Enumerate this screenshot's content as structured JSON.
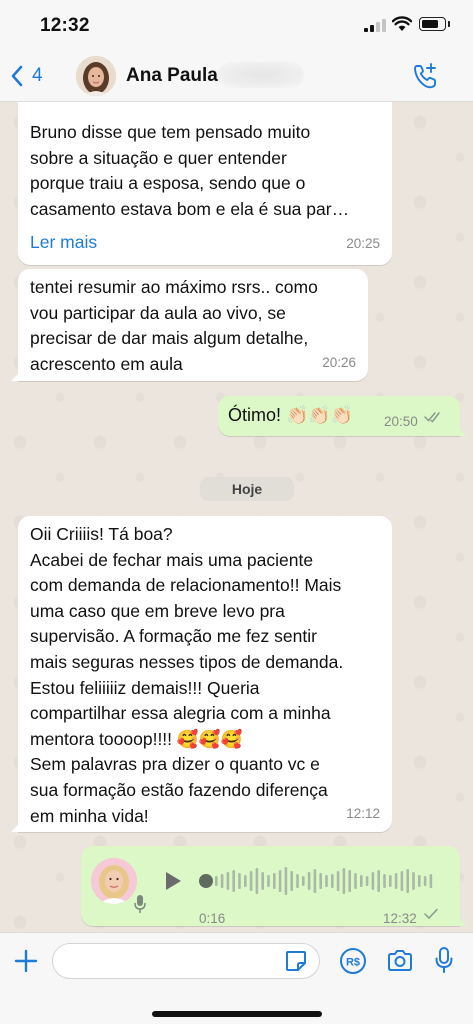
{
  "status_bar": {
    "time": "12:32"
  },
  "header": {
    "back_count": "4",
    "contact_name": "Ana Paula"
  },
  "messages": [
    {
      "direction": "incoming",
      "text": "Bruno disse que tem pensado muito\nsobre a situação e quer entender\nporque traiu a esposa, sendo que o\ncasamento estava bom e ela é sua par…",
      "read_more": "Ler mais",
      "time": "20:25"
    },
    {
      "direction": "incoming",
      "text": "tentei resumir ao máximo rsrs.. como\nvou participar da aula ao vivo, se\nprecisar de dar mais algum detalhe,\nacrescento em aula",
      "time": "20:26"
    },
    {
      "direction": "outgoing",
      "text": "Ótimo! 👏🏻👏🏻👏🏻",
      "time": "20:50",
      "status": "read"
    },
    {
      "direction": "incoming",
      "text": "Oii Criiiis! Tá boa?\nAcabei de fechar mais uma paciente\ncom demanda de relacionamento!! Mais\numa caso que em breve levo pra\nsupervisão. A formação me fez sentir\nmais seguras nesses tipos de demanda.\nEstou feliiiiiz demais!!! Queria\ncompartilhar essa alegria com a minha\nmentora toooop!!!! 🥰🥰🥰\nSem palavras pra dizer o quanto vc e\nsua formação estão fazendo diferença\nem minha vida!",
      "time": "12:12"
    },
    {
      "direction": "outgoing",
      "type": "voice",
      "duration": "0:16",
      "time": "12:32",
      "status": "delivered"
    }
  ],
  "day_separator": "Hoje",
  "colors": {
    "accent": "#1f7bd6",
    "outgoing_bubble": "#dcf8c6",
    "incoming_bubble": "#ffffff",
    "chat_background": "#ece5dd"
  },
  "icons": [
    "back-chevron-icon",
    "add-call-icon",
    "plus-icon",
    "sticker-icon",
    "pix-payment-icon",
    "camera-icon",
    "microphone-icon",
    "play-icon",
    "double-check-icon"
  ]
}
